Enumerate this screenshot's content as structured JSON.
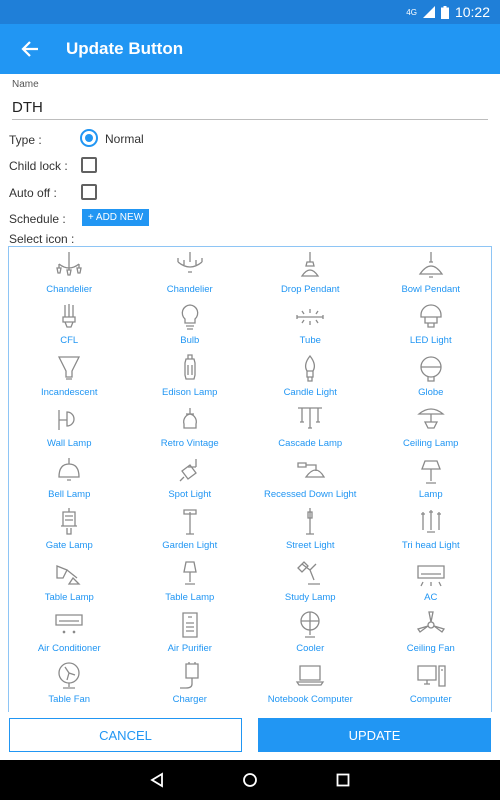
{
  "status": {
    "network": "4G",
    "time": "10:22"
  },
  "appbar": {
    "title": "Update Button"
  },
  "form": {
    "name_label": "Name",
    "name_value": "DTH",
    "type_label": "Type :",
    "type_value": "Normal",
    "child_lock_label": "Child lock :",
    "child_lock_checked": false,
    "auto_off_label": "Auto off :",
    "auto_off_checked": false,
    "schedule_label": "Schedule :",
    "add_new_label": "+ ADD NEW",
    "select_icon_label": "Select icon :"
  },
  "icons": [
    {
      "label": "Chandelier",
      "icon": "chandelier-icon"
    },
    {
      "label": "Chandelier",
      "icon": "chandelier2-icon"
    },
    {
      "label": "Drop Pendant",
      "icon": "drop-pendant-icon"
    },
    {
      "label": "Bowl Pendant",
      "icon": "bowl-pendant-icon"
    },
    {
      "label": "CFL",
      "icon": "cfl-icon"
    },
    {
      "label": "Bulb",
      "icon": "bulb-icon"
    },
    {
      "label": "Tube",
      "icon": "tube-icon"
    },
    {
      "label": "LED Light",
      "icon": "led-light-icon"
    },
    {
      "label": "Incandescent",
      "icon": "incandescent-icon"
    },
    {
      "label": "Edison Lamp",
      "icon": "edison-lamp-icon"
    },
    {
      "label": "Candle Light",
      "icon": "candle-light-icon"
    },
    {
      "label": "Globe",
      "icon": "globe-icon"
    },
    {
      "label": "Wall Lamp",
      "icon": "wall-lamp-icon"
    },
    {
      "label": "Retro Vintage",
      "icon": "retro-vintage-icon"
    },
    {
      "label": "Cascade Lamp",
      "icon": "cascade-lamp-icon"
    },
    {
      "label": "Ceiling Lamp",
      "icon": "ceiling-lamp-icon"
    },
    {
      "label": "Bell Lamp",
      "icon": "bell-lamp-icon"
    },
    {
      "label": "Spot Light",
      "icon": "spot-light-icon"
    },
    {
      "label": "Recessed Down Light",
      "icon": "recessed-down-light-icon"
    },
    {
      "label": "Lamp",
      "icon": "lamp-icon"
    },
    {
      "label": "Gate Lamp",
      "icon": "gate-lamp-icon"
    },
    {
      "label": "Garden Light",
      "icon": "garden-light-icon"
    },
    {
      "label": "Street Light",
      "icon": "street-light-icon"
    },
    {
      "label": "Tri head Light",
      "icon": "tri-head-light-icon"
    },
    {
      "label": "Table Lamp",
      "icon": "table-lamp-icon"
    },
    {
      "label": "Table Lamp",
      "icon": "table-lamp2-icon"
    },
    {
      "label": "Study Lamp",
      "icon": "study-lamp-icon"
    },
    {
      "label": "AC",
      "icon": "ac-icon"
    },
    {
      "label": "Air Conditioner",
      "icon": "air-conditioner-icon"
    },
    {
      "label": "Air Purifier",
      "icon": "air-purifier-icon"
    },
    {
      "label": "Cooler",
      "icon": "cooler-icon"
    },
    {
      "label": "Ceiling Fan",
      "icon": "ceiling-fan-icon"
    },
    {
      "label": "Table Fan",
      "icon": "table-fan-icon"
    },
    {
      "label": "Charger",
      "icon": "charger-icon"
    },
    {
      "label": "Notebook Computer",
      "icon": "notebook-computer-icon"
    },
    {
      "label": "Computer",
      "icon": "computer-icon"
    }
  ],
  "actions": {
    "cancel_label": "CANCEL",
    "update_label": "UPDATE"
  },
  "colors": {
    "primary": "#2196f3",
    "statusbar": "#1f7fd8",
    "icon_stroke": "#8a8a8a"
  }
}
